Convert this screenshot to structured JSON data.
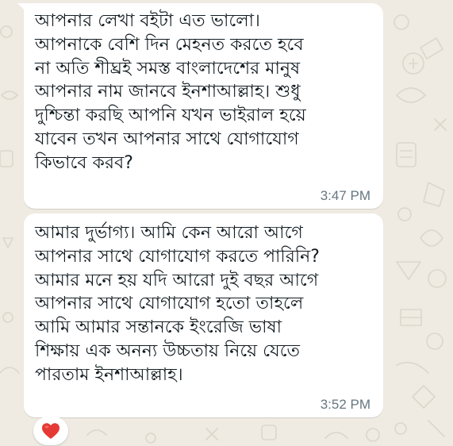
{
  "messages": [
    {
      "text": "আপনার লেখা বইটা এত ভালো।\nআপনাকে বেশি দিন মেহনত করতে হবে\nনা অতি শীঘ্রই সমস্ত বাংলাদেশের মানুষ\nআপনার নাম জানবে ইনশাআল্লাহ। শুধু\nদুশ্চিন্তা করছি আপনি যখন ভাইরাল হয়ে\nযাবেন তখন আপনার সাথে যোগাযোগ\nকিভাবে করব?",
      "time": "3:47 PM"
    },
    {
      "text": "আমার দুর্ভাগ্য। আমি কেন আরো আগে\nআপনার সাথে যোগাযোগ করতে পারিনি?\nআমার মনে হয় যদি আরো দুই  বছর আগে\nআপনার সাথে যোগাযোগ হতো তাহলে\nআমি আমার সন্তানকে ইংরেজি ভাষা\nশিক্ষায় এক অনন্য উচ্চতায় নিয়ে যেতে\nপারতাম ইনশাআল্লাহ।",
      "time": "3:52 PM"
    }
  ],
  "reaction": {
    "icon": "red-heart-icon",
    "color": "#e53935"
  },
  "colors": {
    "background": "#efeae2",
    "bubble": "#ffffff",
    "text": "#111b21",
    "timestamp": "#667781"
  }
}
